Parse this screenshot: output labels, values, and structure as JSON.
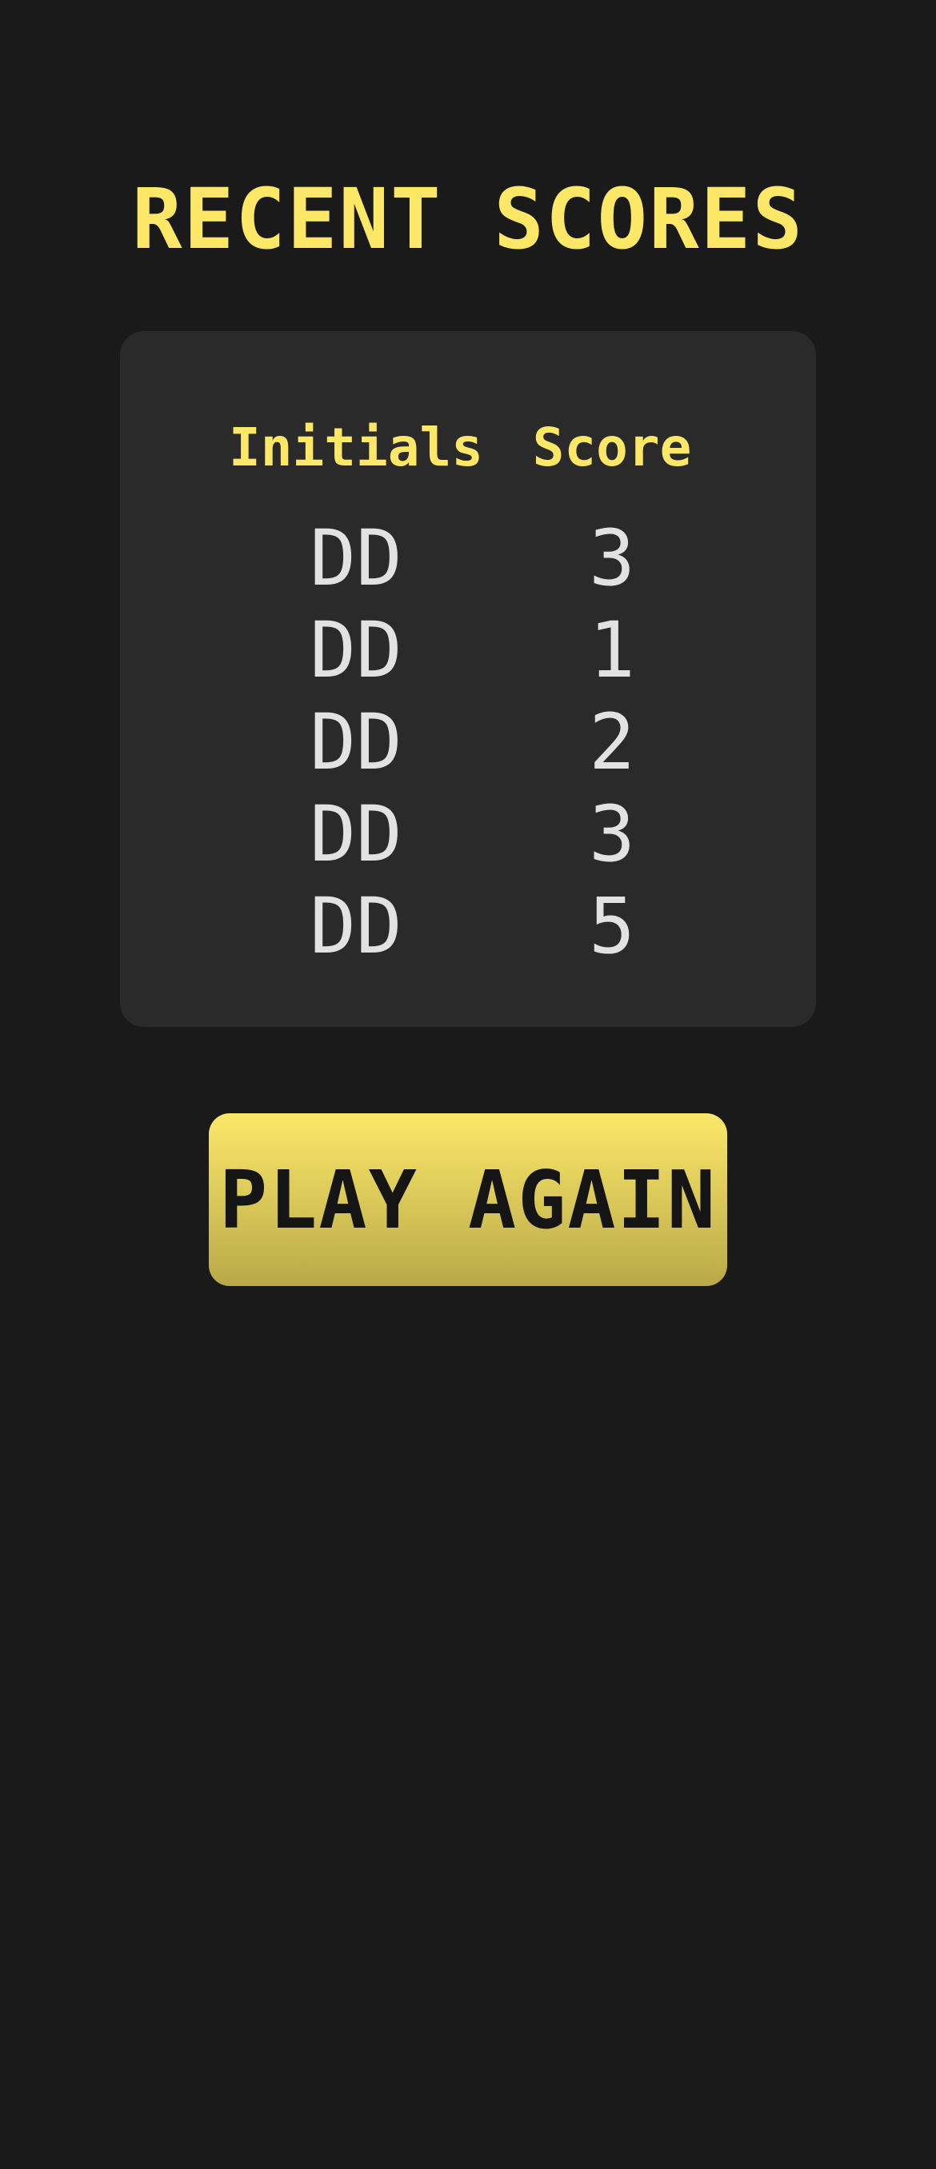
{
  "header": {
    "title": "RECENT SCORES"
  },
  "scores": {
    "columns": {
      "initials": "Initials",
      "score": "Score"
    },
    "rows": [
      {
        "initials": "DD",
        "score": "3"
      },
      {
        "initials": "DD",
        "score": "1"
      },
      {
        "initials": "DD",
        "score": "2"
      },
      {
        "initials": "DD",
        "score": "3"
      },
      {
        "initials": "DD",
        "score": "5"
      }
    ]
  },
  "actions": {
    "play_again_label": "PLAY AGAIN"
  },
  "colors": {
    "background": "#1a1a1a",
    "panel": "#2a2a2a",
    "accent_yellow": "#fde767",
    "score_text": "#e2e2e2",
    "button_text": "#151515"
  }
}
